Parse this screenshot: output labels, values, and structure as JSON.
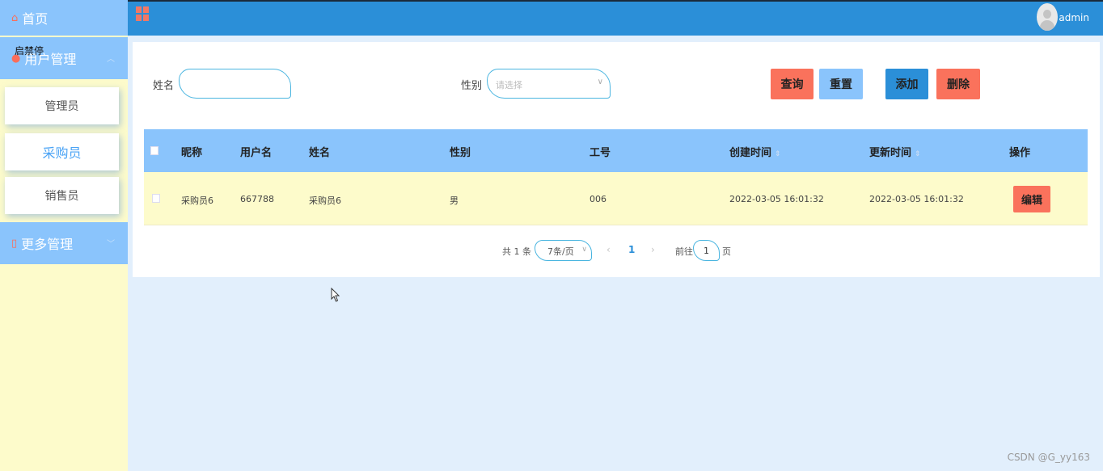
{
  "sidebar": {
    "home_label": "首页",
    "user_mgmt_label": "用户管理",
    "overlay_text": "启禁停",
    "items": [
      {
        "label": "管理员"
      },
      {
        "label": "采购员"
      },
      {
        "label": "销售员"
      }
    ],
    "more_mgmt_label": "更多管理"
  },
  "header": {
    "admin_name": "admin"
  },
  "search": {
    "name_label": "姓名",
    "gender_label": "性别",
    "gender_placeholder": "请选择",
    "query_label": "查询",
    "reset_label": "重置",
    "add_label": "添加",
    "delete_label": "删除"
  },
  "table": {
    "columns": [
      "昵称",
      "用户名",
      "姓名",
      "性别",
      "工号",
      "创建时间",
      "更新时间",
      "操作"
    ],
    "rows": [
      {
        "nickname": "采购员6",
        "username": "667788",
        "name": "采购员6",
        "gender": "男",
        "job_no": "006",
        "created": "2022-03-05 16:01:32",
        "updated": "2022-03-05 16:01:32",
        "action": "编辑"
      }
    ]
  },
  "pagination": {
    "total": "共 1 条",
    "page_size": "7条/页",
    "current_page": "1",
    "goto_label": "前往",
    "goto_value": "1",
    "page_suffix": "页"
  },
  "watermark": "CSDN @G_yy163",
  "colors": {
    "sidebar_blue": "#8ac4fc",
    "header_blue": "#2b8fd8",
    "accent_red": "#fa725c",
    "row_yellow": "#fdfbcb",
    "page_bg": "#e2effc"
  }
}
